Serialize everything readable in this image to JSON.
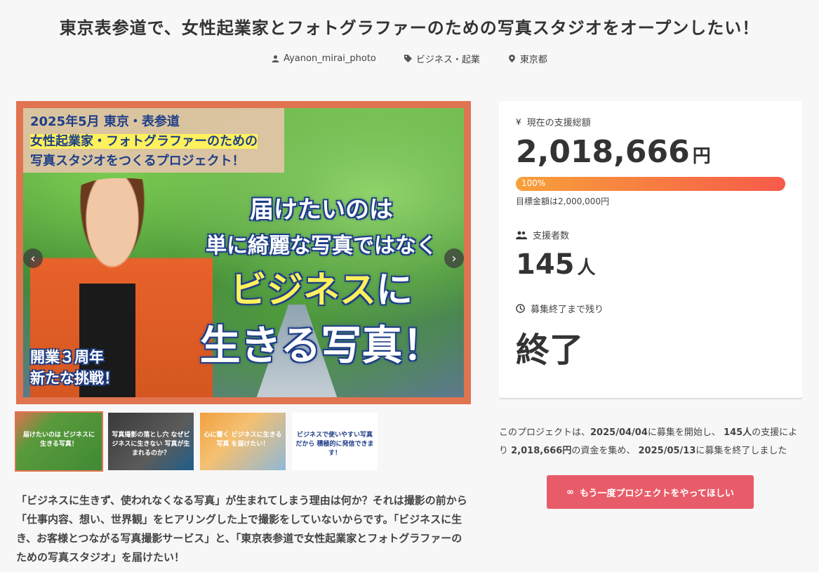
{
  "page": {
    "title": "東京表参道で、女性起業家とフォトグラファーのための写真スタジオをオープンしたい！"
  },
  "meta": {
    "author": "Ayanon_mirai_photo",
    "category": "ビジネス・起業",
    "location": "東京都"
  },
  "hero": {
    "banner_line1": "2025年5月 東京・表参道",
    "banner_line2": "女性起業家・フォトグラファーのための",
    "banner_line3": "写真スタジオをつくるプロジェクト！",
    "headline1": "届けたいのは",
    "headline2": "単に綺麗な写真ではなく",
    "headline3_yellow": "ビジネス",
    "headline3_rest": "に",
    "headline4": "生きる写真！",
    "badge_line1": "開業３周年",
    "badge_line2": "新たな挑戦！",
    "prev_arrow": "‹",
    "next_arrow": "›"
  },
  "thumbnails": [
    {
      "caption": "届けたいのは ビジネスに 生きる写真！"
    },
    {
      "caption": "写真撮影の落とし穴 なぜビジネスに生きない 写真が生まれるのか？"
    },
    {
      "caption": "心に響く ビジネスに生きる写真 を届けたい！"
    },
    {
      "caption": "ビジネスで使いやすい写真だから 積極的に発信できます！"
    }
  ],
  "description": "「ビジネスに生きず、使われなくなる写真」が生まれてしまう理由は何か？それは撮影の前から「仕事内容、想い、世界観」をヒアリングした上で撮影をしていないからです。「ビジネスに生き、お客様とつながる写真撮影サービス」と、「東京表参道で女性起業家とフォトグラファーのための写真スタジオ」を届けたい！",
  "stats": {
    "amount_label": "現在の支援総額",
    "amount_icon": "¥",
    "amount": "2,018,666",
    "amount_unit": "円",
    "progress_percent": "100%",
    "progress_value": 1.0,
    "goal_text": "目標金額は2,000,000円",
    "backers_label": "支援者数",
    "backers": "145",
    "backers_unit": "人",
    "remaining_label": "募集終了まで残り",
    "remaining": "終了"
  },
  "summary": {
    "p1": "このプロジェクトは、",
    "start_date": "2025/04/04",
    "p2": "に募集を開始し、",
    "backers": "145人",
    "p3": "の支援により",
    "amount": "2,018,666円",
    "p4": "の資金を集め、",
    "end_date": "2025/05/13",
    "p5": "に募集を終了しました"
  },
  "cta": {
    "icon": "∞",
    "label": "もう一度プロジェクトをやってほしい"
  },
  "colors": {
    "accent": "#e85c6a",
    "frame": "#e07350",
    "progress_start": "#f7a03a",
    "progress_end": "#f75a4a"
  }
}
